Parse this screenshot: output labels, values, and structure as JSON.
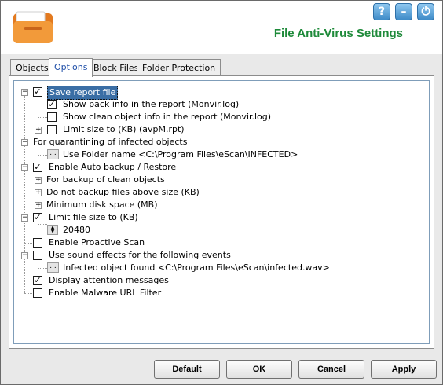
{
  "header": {
    "title": "File Anti-Virus Settings",
    "help_glyph": "?",
    "minimize_glyph": "–",
    "power_glyph": "⏻"
  },
  "tabs": [
    {
      "label": "Objects",
      "active": false
    },
    {
      "label": "Options",
      "active": true
    },
    {
      "label": "Block Files",
      "active": false
    },
    {
      "label": "Folder Protection",
      "active": false
    }
  ],
  "options": {
    "save_report": {
      "label": "Save report file",
      "checked": true
    },
    "show_pack_info": {
      "label": "Show pack info in the report (Monvir.log)",
      "checked": true
    },
    "show_clean_info": {
      "label": "Show clean object info in the report (Monvir.log)",
      "checked": false
    },
    "limit_size": {
      "label": "Limit size to (KB) (avpM.rpt)",
      "checked": false
    },
    "quarantine_header": {
      "label": "For quarantining of infected objects"
    },
    "folder_name": {
      "label": "Use Folder name <C:\\Program Files\\eScan\\INFECTED>"
    },
    "auto_backup": {
      "label": "Enable Auto backup / Restore",
      "checked": true
    },
    "backup_clean": {
      "label": "For backup of clean objects"
    },
    "no_backup_above": {
      "label": "Do not backup files above size (KB)"
    },
    "min_disk_space": {
      "label": "Minimum disk space (MB)"
    },
    "limit_file_size": {
      "label": "Limit file size to (KB)",
      "checked": true
    },
    "file_size_value": "20480",
    "proactive_scan": {
      "label": "Enable Proactive Scan",
      "checked": false
    },
    "sound_effects": {
      "label": "Use sound effects for the following events",
      "checked": false
    },
    "infected_sound": {
      "label": "Infected object found <C:\\Program Files\\eScan\\infected.wav>"
    },
    "attention_messages": {
      "label": "Display attention messages",
      "checked": true
    },
    "malware_url_filter": {
      "label": "Enable Malware URL Filter",
      "checked": false
    }
  },
  "glyphs": {
    "check": "✓",
    "plus": "+",
    "minus": "−",
    "dots": "...",
    "up": "▲",
    "down": "▼"
  },
  "buttons": {
    "default": "Default",
    "ok": "OK",
    "cancel": "Cancel",
    "apply": "Apply"
  },
  "colors": {
    "title_green": "#1e8a3a",
    "selection_blue": "#3a6ea5",
    "header_button_blue": "#3f8cc8"
  }
}
